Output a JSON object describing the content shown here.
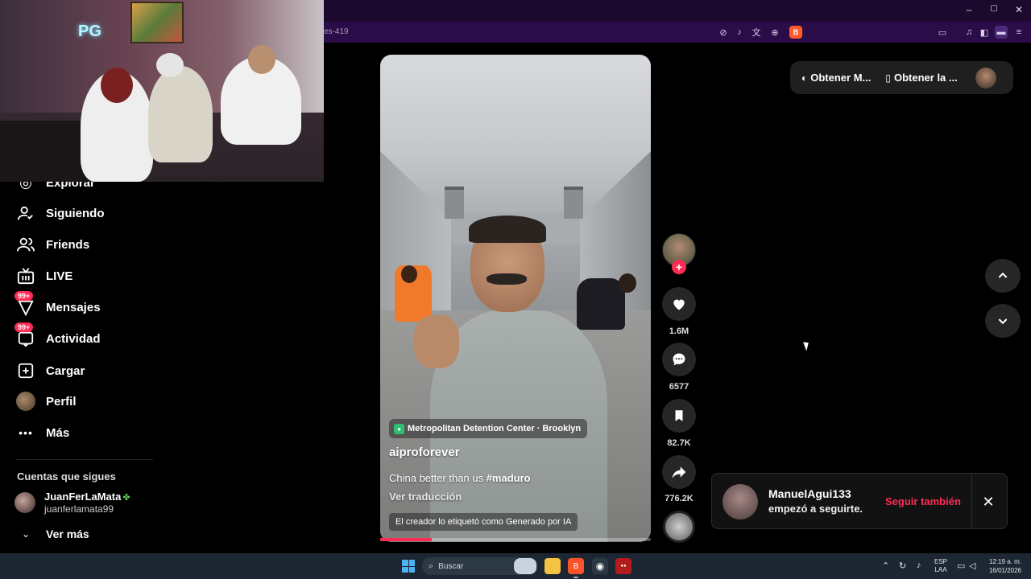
{
  "browser": {
    "url_fragment": "es-419",
    "toolbar_icons": [
      "mute-icon",
      "no-sound-icon",
      "translate-icon",
      "zoom-icon",
      "brave-shield-icon",
      "tab-icon",
      "music-icon",
      "sidebar-icon",
      "wallet-icon",
      "menu-icon"
    ]
  },
  "window_controls": [
    "–",
    "▢",
    "✕"
  ],
  "sidebar": {
    "items": [
      {
        "label": "Explorar",
        "icon": "compass-icon"
      },
      {
        "label": "Siguiendo",
        "icon": "user-follow-icon"
      },
      {
        "label": "Friends",
        "icon": "friends-icon"
      },
      {
        "label": "LIVE",
        "icon": "live-tv-icon"
      },
      {
        "label": "Mensajes",
        "icon": "messages-icon",
        "badge": "99+"
      },
      {
        "label": "Actividad",
        "icon": "activity-icon",
        "badge": "99+"
      },
      {
        "label": "Cargar",
        "icon": "upload-icon"
      },
      {
        "label": "Perfil",
        "icon": "profile-avatar"
      },
      {
        "label": "Más",
        "icon": "more-icon"
      }
    ],
    "following_title": "Cuentas que sigues",
    "following": [
      {
        "name": "JuanFerLaMata",
        "handle": "juanferlamata99"
      }
    ],
    "see_more": "Ver más"
  },
  "video": {
    "location": "Metropolitan Detention Center · Brooklyn",
    "author": "aiproforever",
    "caption_text": "China better than us ",
    "caption_tag": "#maduro",
    "translate": "Ver traducción",
    "ai_label": "El creador lo etiquetó como Generado por IA",
    "progress": 0.19
  },
  "actions": {
    "likes": "1.6M",
    "comments": "6577",
    "saves": "82.7K",
    "shares": "776.2K"
  },
  "header": {
    "btn1": "Obtener M...",
    "btn2": "Obtener la ..."
  },
  "notification": {
    "user": "ManuelAgui133",
    "message": "empezó a seguirte.",
    "action": "Seguir también"
  },
  "taskbar": {
    "search": "Buscar",
    "lang_line1": "ESP",
    "lang_line2": "LAA",
    "time": "12:19 a. m.",
    "date": "16/01/2026"
  },
  "colors": {
    "accent": "#fe2c55",
    "browser_bar": "#2a0d48",
    "taskbar": "#1d2733"
  }
}
